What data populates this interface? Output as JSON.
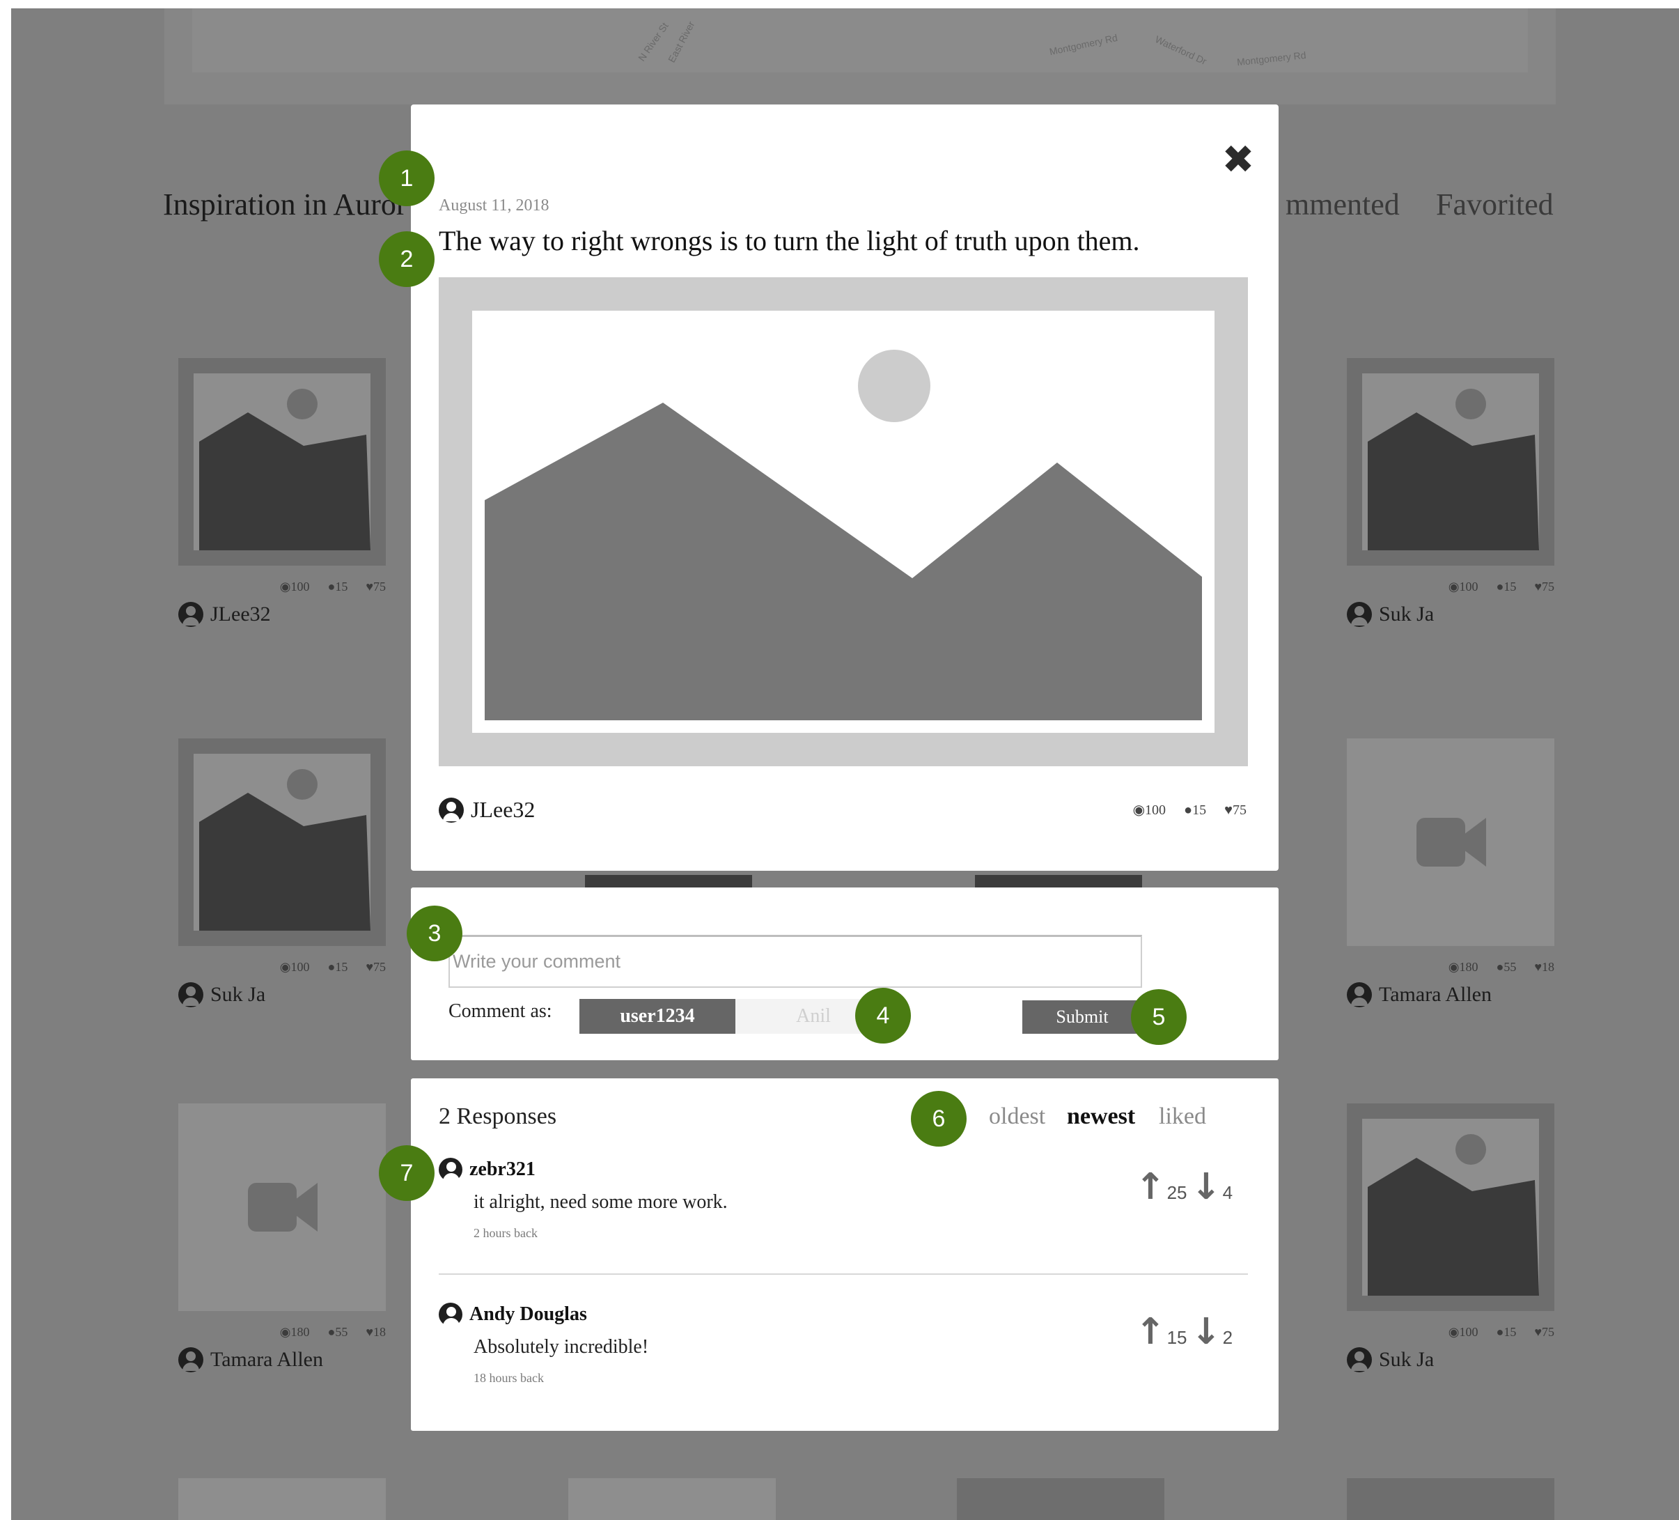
{
  "background": {
    "map_labels": [
      "Montgomery Rd",
      "Waterford Dr",
      "Montgomery Rd",
      "N River St",
      "East River"
    ],
    "section_title": "Inspiration in Auror",
    "tabs": [
      "mmented",
      "Favorited"
    ],
    "cards": [
      {
        "author": "JLee32",
        "views": "100",
        "comments": "15",
        "likes": "75",
        "media": "image"
      },
      {
        "author": "Suk Ja",
        "views": "100",
        "comments": "15",
        "likes": "75",
        "media": "image"
      },
      {
        "author": "Suk Ja",
        "views": "100",
        "comments": "15",
        "likes": "75",
        "media": "image"
      },
      {
        "author": "Tamara Allen",
        "views": "180",
        "comments": "55",
        "likes": "18",
        "media": "video"
      },
      {
        "author": "Tamara Allen",
        "views": "180",
        "comments": "55",
        "likes": "18",
        "media": "video"
      },
      {
        "author": "Suk Ja",
        "views": "100",
        "comments": "15",
        "likes": "75",
        "media": "image"
      }
    ]
  },
  "post": {
    "date": "August 11, 2018",
    "quote": "The way to right wrongs is to turn the light of truth upon them.",
    "author": "JLee32",
    "views": "100",
    "comments": "15",
    "likes": "75",
    "close_icon": "close-icon"
  },
  "comment_form": {
    "placeholder": "Write your comment",
    "value": "",
    "comment_as_label": "Comment as:",
    "identities": [
      "user1234",
      "Anil"
    ],
    "selected_identity": "user1234",
    "submit_label": "Submit"
  },
  "responses": {
    "count_label": "2 Responses",
    "sort_options": [
      "oldest",
      "newest",
      "liked"
    ],
    "active_sort": "newest",
    "items": [
      {
        "user": "zebr321",
        "text": "it alright, need some more work.",
        "time": "2 hours back",
        "upvotes": "25",
        "downvotes": "4"
      },
      {
        "user": "Andy Douglas",
        "text": "Absolutely incredible!",
        "time": "18 hours back",
        "upvotes": "15",
        "downvotes": "2"
      }
    ]
  },
  "markers": [
    "1",
    "2",
    "3",
    "4",
    "5",
    "6",
    "7"
  ],
  "colors": {
    "marker_green": "#4a7c12",
    "overlay_gray": "#7f7f7f",
    "button_dark": "#666666",
    "image_placeholder": "#cccccc",
    "mountain": "#777777"
  }
}
